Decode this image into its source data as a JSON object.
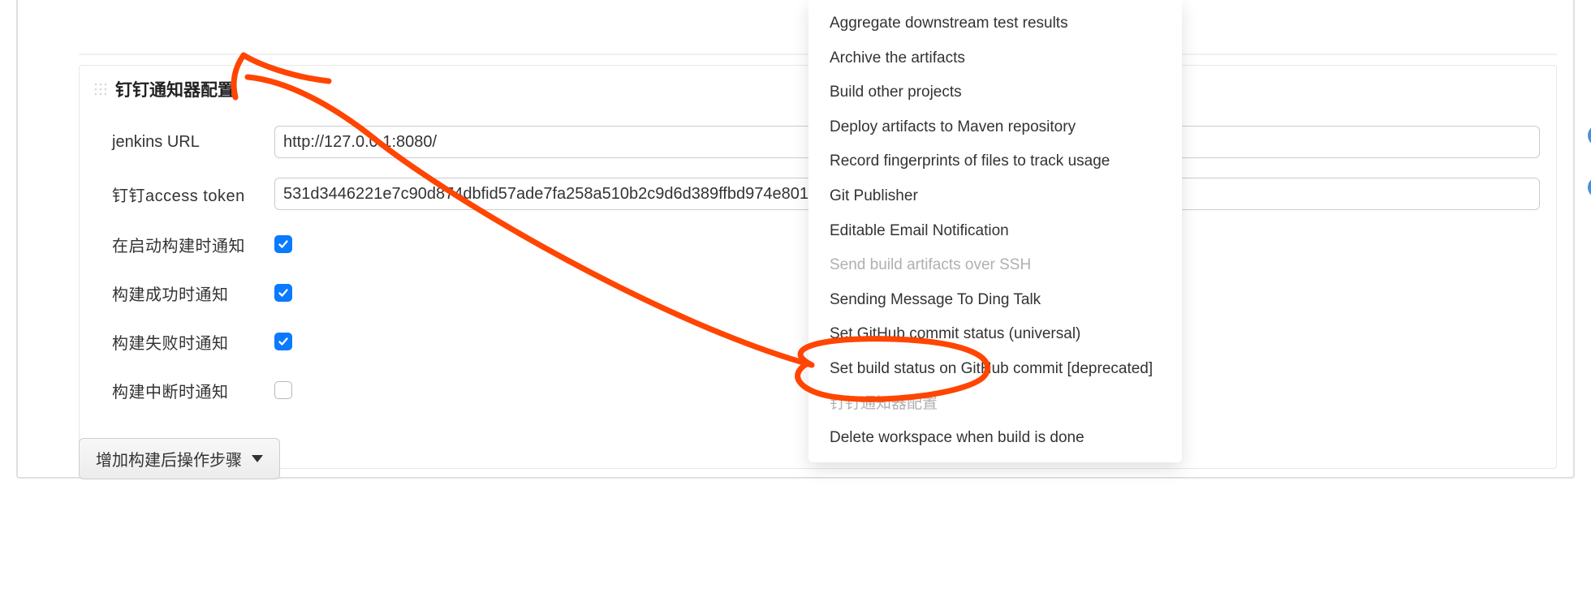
{
  "section": {
    "title": "钉钉通知器配置",
    "fields": {
      "jenkins_url": {
        "label": "jenkins URL",
        "value": "http://127.0.0.1:8080/"
      },
      "access_token": {
        "label": "钉钉access token",
        "value": "531d3446221e7c90d874dbfid57ade7fa258a510b2c9d6d389ffbd974e801"
      },
      "notify_on_start": {
        "label": "在启动构建时通知",
        "checked": true
      },
      "notify_on_success": {
        "label": "构建成功时通知",
        "checked": true
      },
      "notify_on_failure": {
        "label": "构建失败时通知",
        "checked": true
      },
      "notify_on_abort": {
        "label": "构建中断时通知",
        "checked": false
      }
    }
  },
  "dropdown": {
    "items": [
      {
        "label": "Aggregate downstream test results",
        "disabled": false
      },
      {
        "label": "Archive the artifacts",
        "disabled": false
      },
      {
        "label": "Build other projects",
        "disabled": false
      },
      {
        "label": "Deploy artifacts to Maven repository",
        "disabled": false
      },
      {
        "label": "Record fingerprints of files to track usage",
        "disabled": false
      },
      {
        "label": "Git Publisher",
        "disabled": false
      },
      {
        "label": "Editable Email Notification",
        "disabled": false
      },
      {
        "label": "Send build artifacts over SSH",
        "disabled": true
      },
      {
        "label": "Sending Message To Ding Talk",
        "disabled": false
      },
      {
        "label": "Set GitHub commit status (universal)",
        "disabled": false
      },
      {
        "label": "Set build status on GitHub commit [deprecated]",
        "disabled": false
      },
      {
        "label": "钉钉通知器配置",
        "disabled": true
      },
      {
        "label": "Delete workspace when build is done",
        "disabled": false
      }
    ]
  },
  "footer": {
    "add_step_label": "增加构建后操作步骤"
  },
  "help": {
    "glyph": "?"
  },
  "colors": {
    "accent": "#0a7aff",
    "annotation": "#ff4500"
  }
}
